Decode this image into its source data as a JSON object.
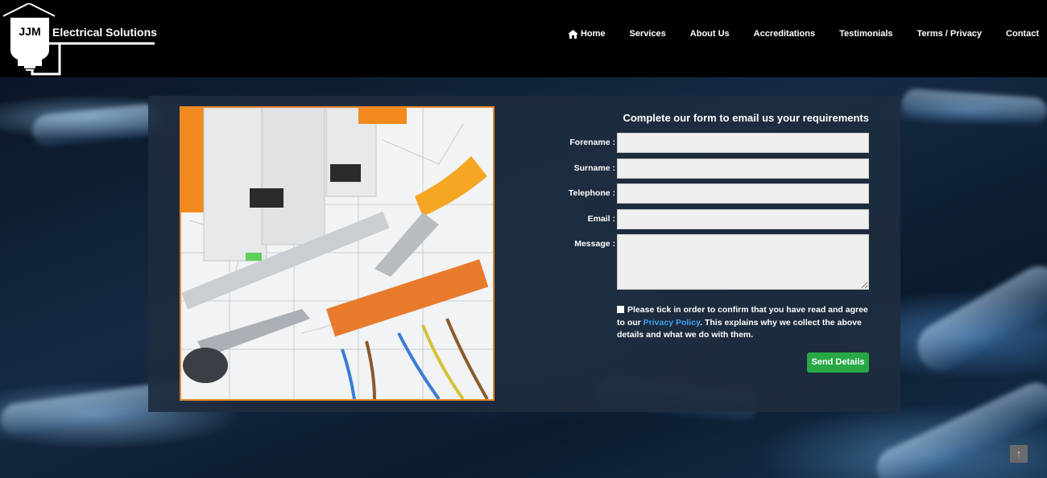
{
  "brand": {
    "initials": "JJM",
    "name": "Electrical Solutions"
  },
  "nav": {
    "items": [
      {
        "label": "Home",
        "icon": "home-icon"
      },
      {
        "label": "Services"
      },
      {
        "label": "About Us"
      },
      {
        "label": "Accreditations"
      },
      {
        "label": "Testimonials"
      },
      {
        "label": "Terms / Privacy"
      },
      {
        "label": "Contact"
      }
    ]
  },
  "form": {
    "title": "Complete our form to email us your requirements",
    "fields": [
      {
        "label": "Forename :",
        "value": ""
      },
      {
        "label": "Surname :",
        "value": ""
      },
      {
        "label": "Telephone :",
        "value": ""
      },
      {
        "label": "Email :",
        "value": ""
      },
      {
        "label": "Message :",
        "value": ""
      }
    ],
    "consent": {
      "before": "Please tick in order to confirm that you have read and agree to our ",
      "link": "Privacy Policy",
      "after": ". This explains why we collect the above details and what we do with them."
    },
    "submit_label": "Send Details"
  },
  "scroll_top": {
    "label": "↑"
  },
  "colors": {
    "header_bg": "#000000",
    "accent_orange": "#e8892b",
    "button_green": "#27a844",
    "link_blue": "#3ba3f0"
  }
}
